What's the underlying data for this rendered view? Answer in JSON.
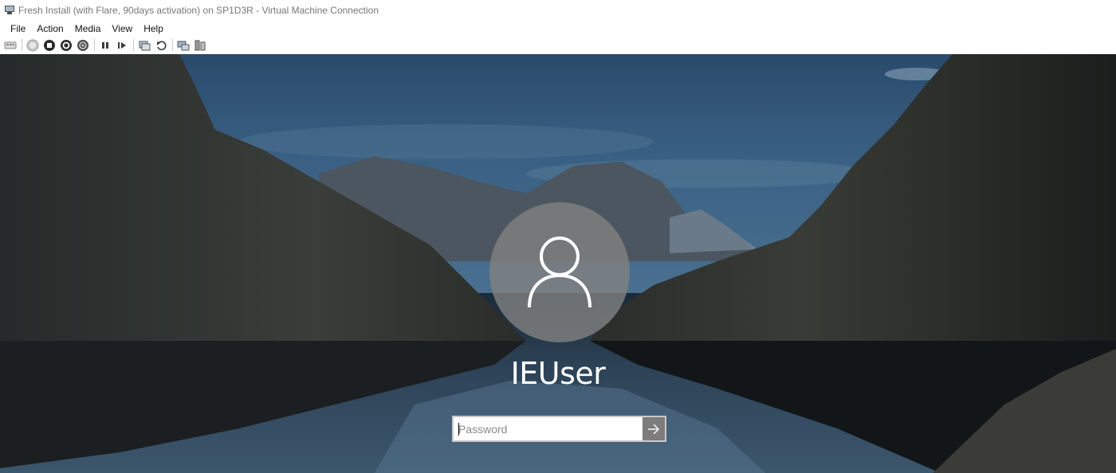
{
  "window": {
    "title": "Fresh Install (with Flare, 90days activation) on SP1D3R - Virtual Machine Connection",
    "icon": "vm-connection-icon"
  },
  "menu": {
    "items": [
      {
        "label": "File"
      },
      {
        "label": "Action"
      },
      {
        "label": "Media"
      },
      {
        "label": "View"
      },
      {
        "label": "Help"
      }
    ]
  },
  "toolbar": {
    "buttons": [
      {
        "icon": "ctrl-alt-del-icon"
      },
      {
        "icon": "start-icon"
      },
      {
        "icon": "turn-off-icon"
      },
      {
        "icon": "shut-down-icon"
      },
      {
        "icon": "save-icon"
      },
      {
        "icon": "pause-icon"
      },
      {
        "icon": "resume-icon"
      },
      {
        "icon": "checkpoint-icon"
      },
      {
        "icon": "revert-icon"
      },
      {
        "icon": "enhanced-session-icon"
      },
      {
        "icon": "share-icon"
      }
    ]
  },
  "login": {
    "username": "IEUser",
    "password_placeholder": "Password",
    "password_value": "",
    "avatar_icon": "user-avatar-icon",
    "submit_icon": "arrow-right-icon"
  },
  "colors": {
    "text_white": "#ffffff",
    "avatar_bg": "#808080",
    "submit_bg": "#7d7d7d"
  }
}
